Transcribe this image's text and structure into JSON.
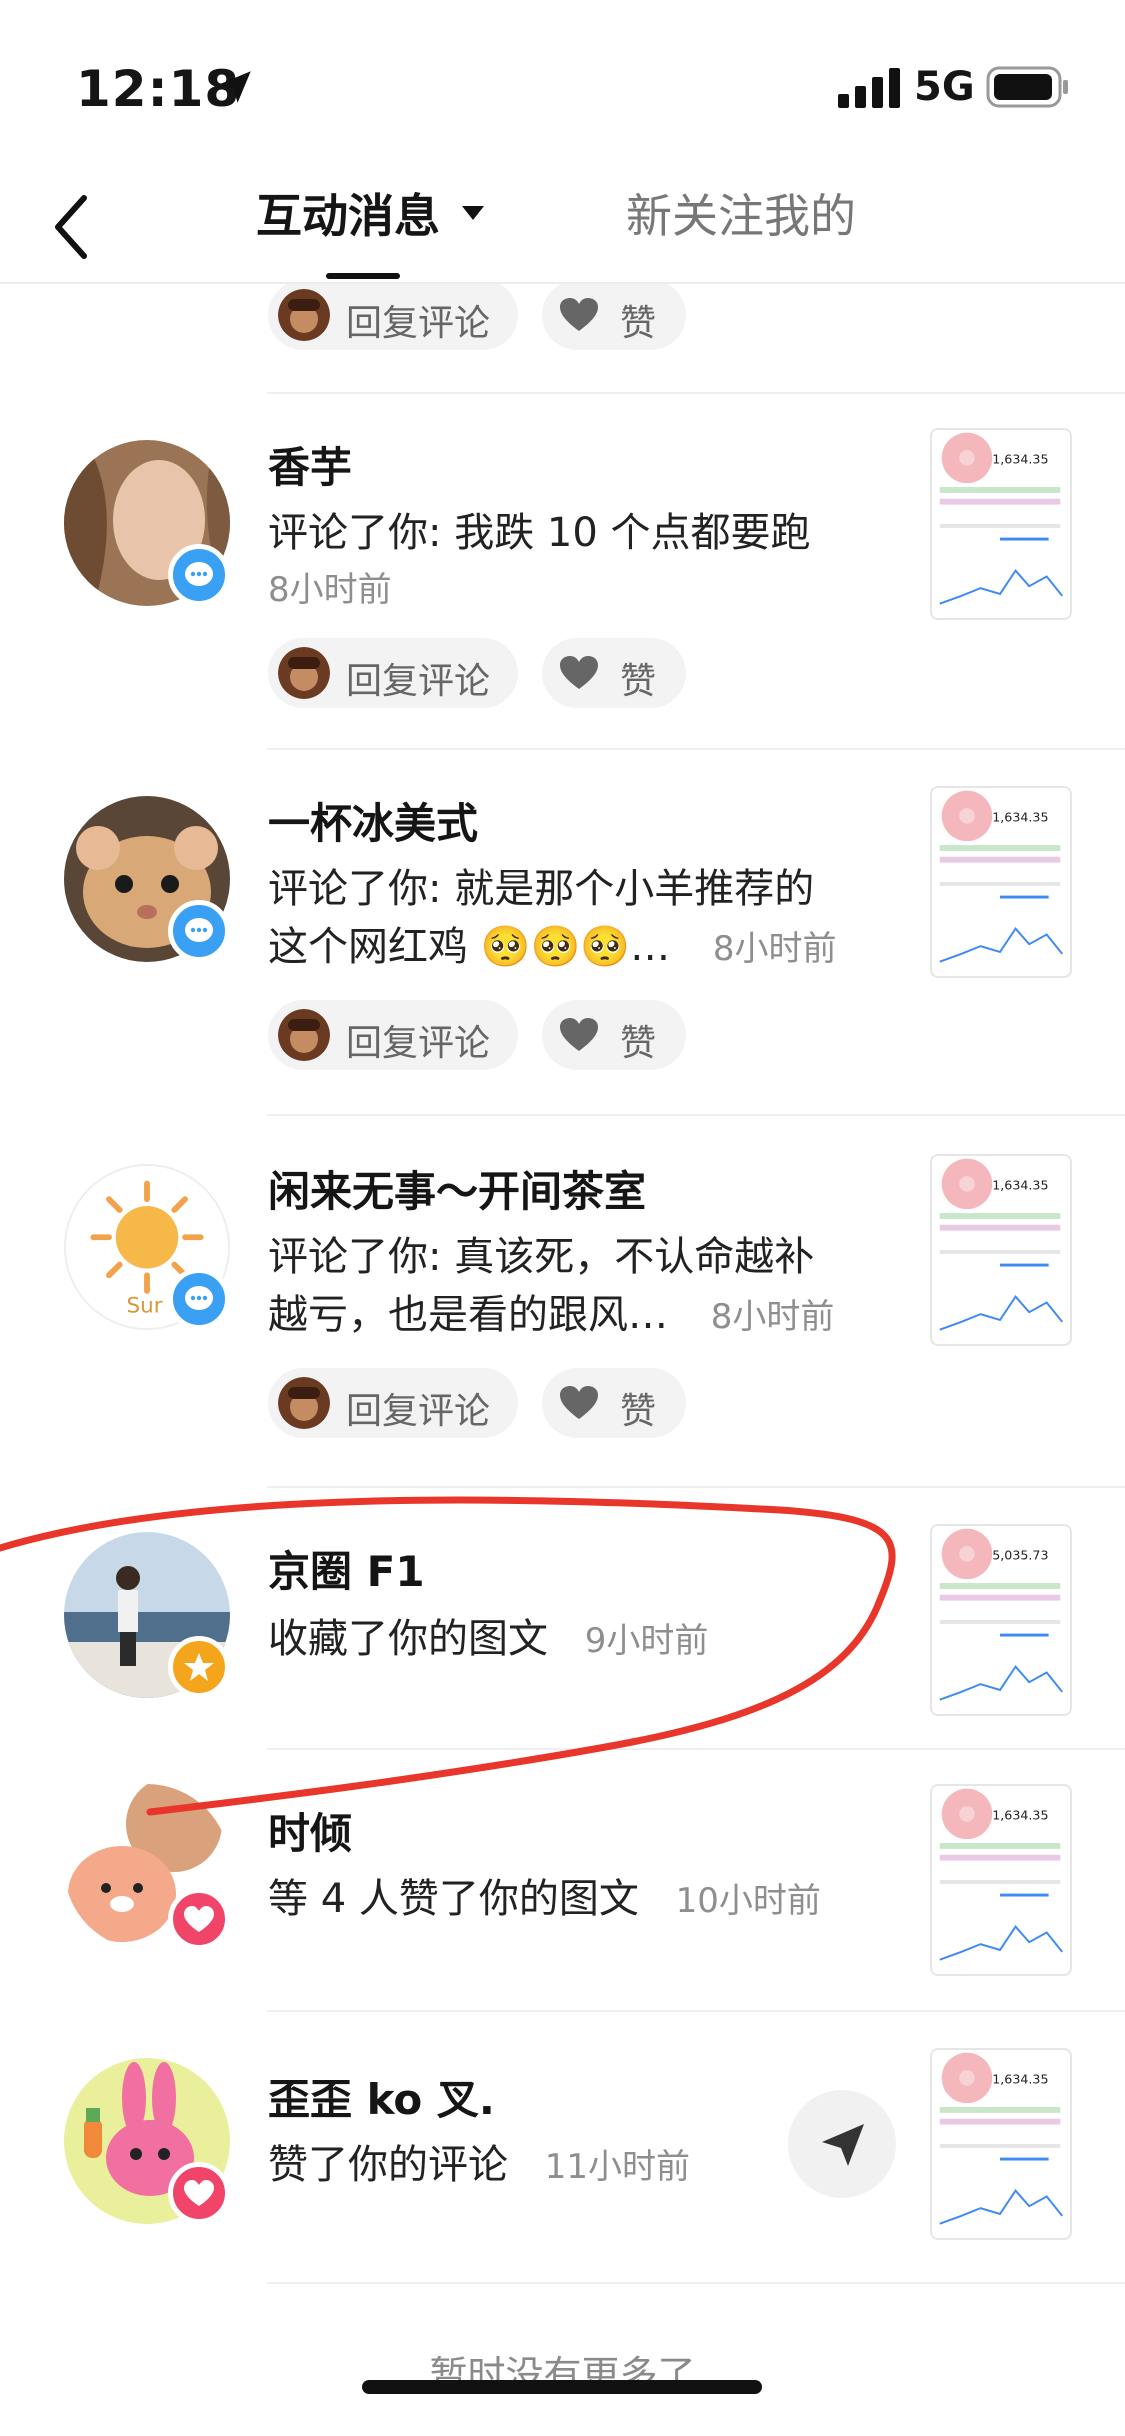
{
  "status_bar": {
    "time": "12:18",
    "network": "5G"
  },
  "nav": {
    "active_tab": "互动消息",
    "other_tab": "新关注我的"
  },
  "actions": {
    "reply_label": "回复评论",
    "like_label": "赞"
  },
  "items": [
    {
      "name": "香芋",
      "line1": "评论了你: 我跌 10 个点都要跑",
      "time": "8小时前",
      "thumb_value": "1,634.35"
    },
    {
      "name": "一杯冰美式",
      "line1": "评论了你: 就是那个小羊推荐的",
      "line2": "这个网红鸡 🥺🥺🥺…",
      "time": "8小时前",
      "thumb_value": "1,634.35"
    },
    {
      "name": "闲来无事～开间茶室",
      "line1": "评论了你: 真该死，不认命越补",
      "line2": "越亏，也是看的跟风…",
      "time": "8小时前",
      "thumb_value": "1,634.35"
    },
    {
      "name": "京圈 F1",
      "line1": "收藏了你的图文",
      "time": "9小时前",
      "thumb_value": "5,035.73"
    },
    {
      "name": "时倾",
      "line1": "等 4 人赞了你的图文",
      "time": "10小时前",
      "thumb_value": "1,634.35"
    },
    {
      "name": "歪歪 ko 叉.",
      "line1": "赞了你的评论",
      "time": "11小时前",
      "thumb_value": "1,634.35"
    }
  ],
  "footer": {
    "text": "暂时没有更多了"
  },
  "colors": {
    "comment_badge": "#3aa0f3",
    "star_badge": "#f4a51c",
    "like_badge": "#f04468",
    "annotation": "#e8362b"
  }
}
